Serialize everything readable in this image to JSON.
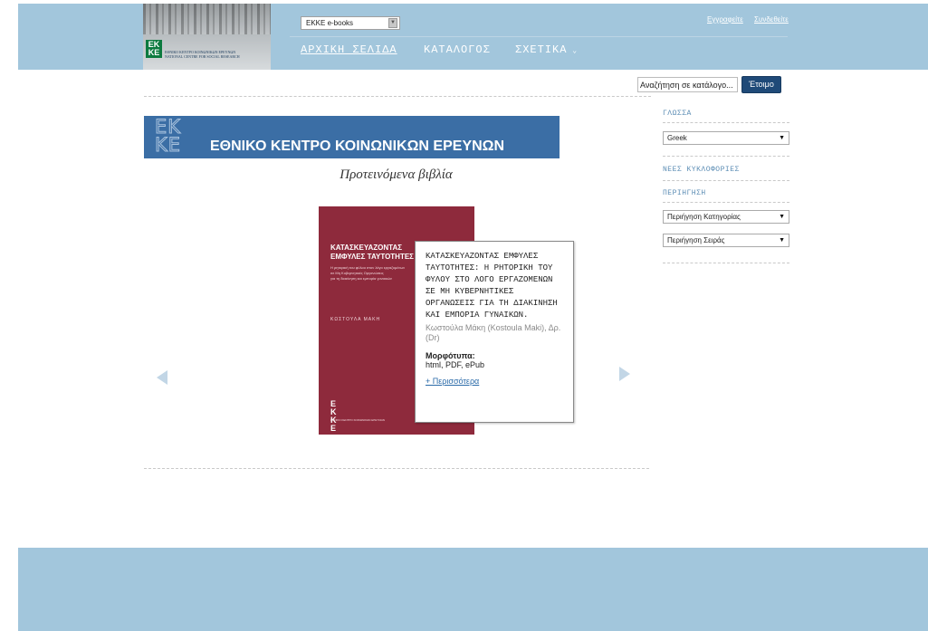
{
  "header": {
    "logo": {
      "line1": "ΕΘΝΙΚΟ ΚΕΝΤΡΟ ΚΟΙΝΩΝΙΚΩΝ ΕΡΕΥΝΩΝ",
      "line2": "NATIONAL CENTRE FOR SOCIAL RESEARCH",
      "mark": "EK KE"
    },
    "site_select": "EKKE e-books",
    "nav": [
      "ΑΡΧΙΚΗ ΣΕΛΙΔΑ",
      "ΚΑΤΑΛΟΓΟΣ",
      "ΣΧΕΤΙΚΑ"
    ],
    "register": "Εγγραφείτε",
    "login": "Συνδεθείτε"
  },
  "search": {
    "placeholder": "Αναζήτηση σε κατάλογο...",
    "button": "Έτοιμο"
  },
  "banner": {
    "mark": "EK KE",
    "title": "ΕΘΝΙΚΟ ΚΕΝΤΡΟ ΚΟΙΝΩΝΙΚΩΝ ΕΡΕΥΝΩΝ"
  },
  "featured": {
    "heading": "Προτεινόμενα βιβλία",
    "cover": {
      "title_line1": "ΚΑΤΑΣΚΕΥΑΖΟΝΤΑΣ",
      "title_line2": "ΕΜΦΥΛΕΣ ΤΑΥΤΟΤΗΤΕΣ",
      "subtitle_line1": "Η ρητορική του φύλου στον λόγο εργαζομένων",
      "subtitle_line2": "σε Μη Κυβερνητικές Οργανώσεις",
      "subtitle_line3": "για τη διακίνηση και εμπορία γυναικών",
      "author": "ΚΩΣΤΟΥΛΑ ΜΑΚΗ",
      "mark": "EK KE",
      "publisher": "ΕΘΝΙΚΟ ΚΕΝΤΡΟ ΚΟΙΝΩΝΙΚΩΝ ΕΡΕΥΝΩΝ"
    },
    "popup": {
      "title": "ΚΑΤΑΣΚΕΥΑΖΟΝΤΑΣ ΕΜΦΥΛΕΣ ΤΑΥΤΟΤΗΤΕΣ: Η ΡΗΤΟΡΙΚΗ ΤΟΥ ΦΥΛΟΥ ΣΤΟ ΛΟΓΟ ΕΡΓΑΖΟΜΕΝΩΝ ΣΕ ΜΗ ΚΥΒΕΡΝΗΤΙΚΕΣ ΟΡΓΑΝΩΣΕΙΣ ΓΙΑ ΤΗ ΔΙΑΚΙΝΗΣΗ ΚΑΙ ΕΜΠΟΡΙΑ ΓΥΝΑΙΚΩΝ.",
      "author": "Κωστούλα Μάκη (Kostoula Maki), Δρ. (Dr)",
      "formats_label": "Μορφότυπα:",
      "formats": "html, PDF, ePub",
      "more": "+ Περισσότερα"
    }
  },
  "sidebar": {
    "language_heading": "ΓΛΩΣΣΑ",
    "language_value": "Greek",
    "new_releases_heading": "ΝΕΕΣ ΚΥΚΛΟΦΟΡΙΕΣ",
    "browse_heading": "ΠΕΡΙΗΓΗΣΗ",
    "browse_category": "Περιήγηση Κατηγορίας",
    "browse_series": "Περιήγηση Σειράς"
  },
  "colors": {
    "header_bg": "#a2c6dc",
    "accent_blue": "#1f4a78",
    "cover_red": "#8e2a3c",
    "banner_blue": "#3b6ea5"
  }
}
